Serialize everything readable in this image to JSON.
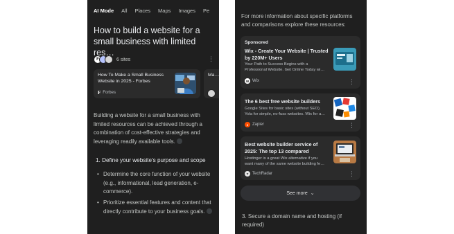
{
  "left_screen": {
    "tabs": [
      "AI Mode",
      "All",
      "Places",
      "Maps",
      "Images",
      "Pe"
    ],
    "title": "How to build a website for a small business with limited res…",
    "sources": {
      "count_label": "6 sites",
      "favicons": [
        "F",
        "●",
        "●"
      ]
    },
    "source_card": {
      "title": "How To Make a Small Business Website in 2025 - Forbes",
      "site": "Forbes",
      "site_glyph": "F"
    },
    "source_card_2": {
      "title": "Ma…"
    },
    "paragraph": "Building a website for a small business with limited resources can be achieved through a combination of cost-effective strategies and leveraging readily available tools.",
    "step": "1. Define your website's purpose and scope",
    "bullets": [
      "Determine the core function of your website (e.g., informational, lead generation, e-commerce).",
      "Prioritize essential features and content that directly contribute to your business goals."
    ]
  },
  "right_screen": {
    "intro": "For more information about specific platforms and comparisons explore these resources:",
    "results": [
      {
        "sponsored": "Sponsored",
        "title": "Wix - Create Your Website | Trusted by 220M+ Users",
        "snippet": [
          "Your Path to Success Begins with a",
          "Professional Website. Get Online Today wi…"
        ],
        "site": "Wix",
        "site_glyph": "W"
      },
      {
        "title": "The 6 best free website builders",
        "snippet": [
          "Google Sites for basic sites (without SEO).",
          "Yola for simple, no-fuss websites. Wix for a…"
        ],
        "site": "Zapier",
        "site_glyph": "z"
      },
      {
        "title": "Best website builder service of 2025: The top 13 compared",
        "snippet": [
          "Hostinger is a great Wix alternative if you",
          "want many of the same website building fe…"
        ],
        "site": "TechRadar",
        "site_glyph": "T"
      }
    ],
    "see_more": "See more",
    "step3": "3. Secure a domain name and hosting (if required)"
  },
  "colors": {
    "background": "#1f1f1f",
    "card": "#2b2b2b",
    "text_primary": "#e8eaed",
    "text_secondary": "#c4c7c5",
    "zapier_orange": "#ff4f00"
  },
  "icons": [
    "kebab-menu-icon",
    "link-icon",
    "chevron-down-icon",
    "wix-logo-icon",
    "zapier-logo-icon",
    "techradar-logo-icon",
    "forbes-logo-icon"
  ]
}
